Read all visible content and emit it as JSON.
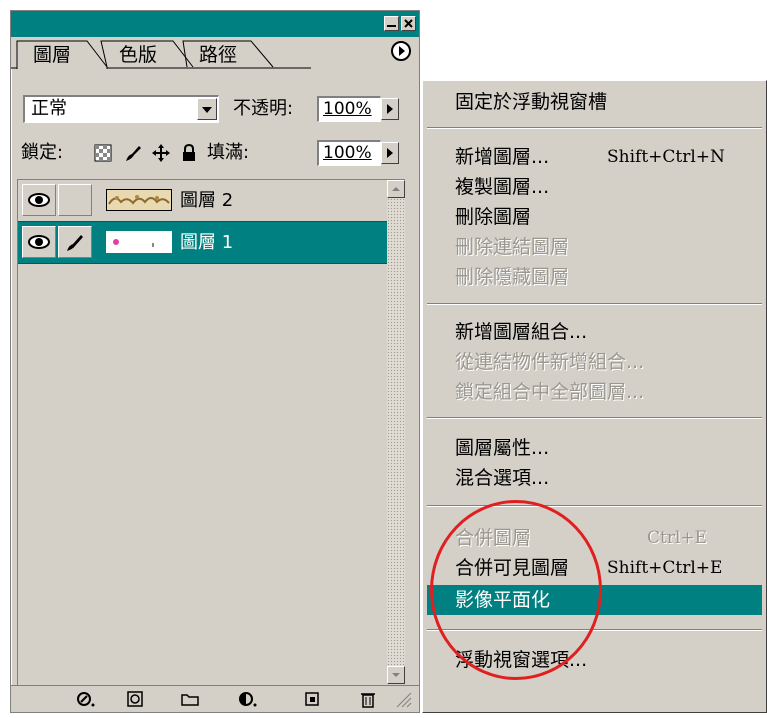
{
  "panel": {
    "tabs": [
      "圖層",
      "色版",
      "路徑"
    ],
    "blend_mode": "正常",
    "opacity_label": "不透明:",
    "opacity_value": "100%",
    "lock_label": "鎖定:",
    "fill_label": "填滿:",
    "fill_value": "100%",
    "layers": [
      {
        "name": "圖層 2",
        "selected": false
      },
      {
        "name": "圖層 1",
        "selected": true
      }
    ]
  },
  "menu": {
    "items": [
      {
        "label": "固定於浮動視窗槽",
        "shortcut": "",
        "state": "enabled"
      },
      {
        "label": "新增圖層...",
        "shortcut": "Shift+Ctrl+N",
        "state": "enabled"
      },
      {
        "label": "複製圖層...",
        "shortcut": "",
        "state": "enabled"
      },
      {
        "label": "刪除圖層",
        "shortcut": "",
        "state": "enabled"
      },
      {
        "label": "刪除連結圖層",
        "shortcut": "",
        "state": "disabled"
      },
      {
        "label": "刪除隱藏圖層",
        "shortcut": "",
        "state": "disabled"
      },
      {
        "label": "新增圖層組合...",
        "shortcut": "",
        "state": "enabled"
      },
      {
        "label": "從連結物件新增組合...",
        "shortcut": "",
        "state": "disabled"
      },
      {
        "label": "鎖定組合中全部圖層...",
        "shortcut": "",
        "state": "disabled"
      },
      {
        "label": "圖層屬性...",
        "shortcut": "",
        "state": "enabled"
      },
      {
        "label": "混合選項...",
        "shortcut": "",
        "state": "enabled"
      },
      {
        "label": "合併圖層",
        "shortcut": "Ctrl+E",
        "state": "disabled"
      },
      {
        "label": "合併可見圖層",
        "shortcut": "Shift+Ctrl+E",
        "state": "enabled"
      },
      {
        "label": "影像平面化",
        "shortcut": "",
        "state": "highlighted"
      },
      {
        "label": "浮動視窗選項...",
        "shortcut": "",
        "state": "enabled"
      }
    ]
  },
  "colors": {
    "accent": "#008080",
    "face": "#d4d0c8",
    "annotation": "#e02020"
  }
}
